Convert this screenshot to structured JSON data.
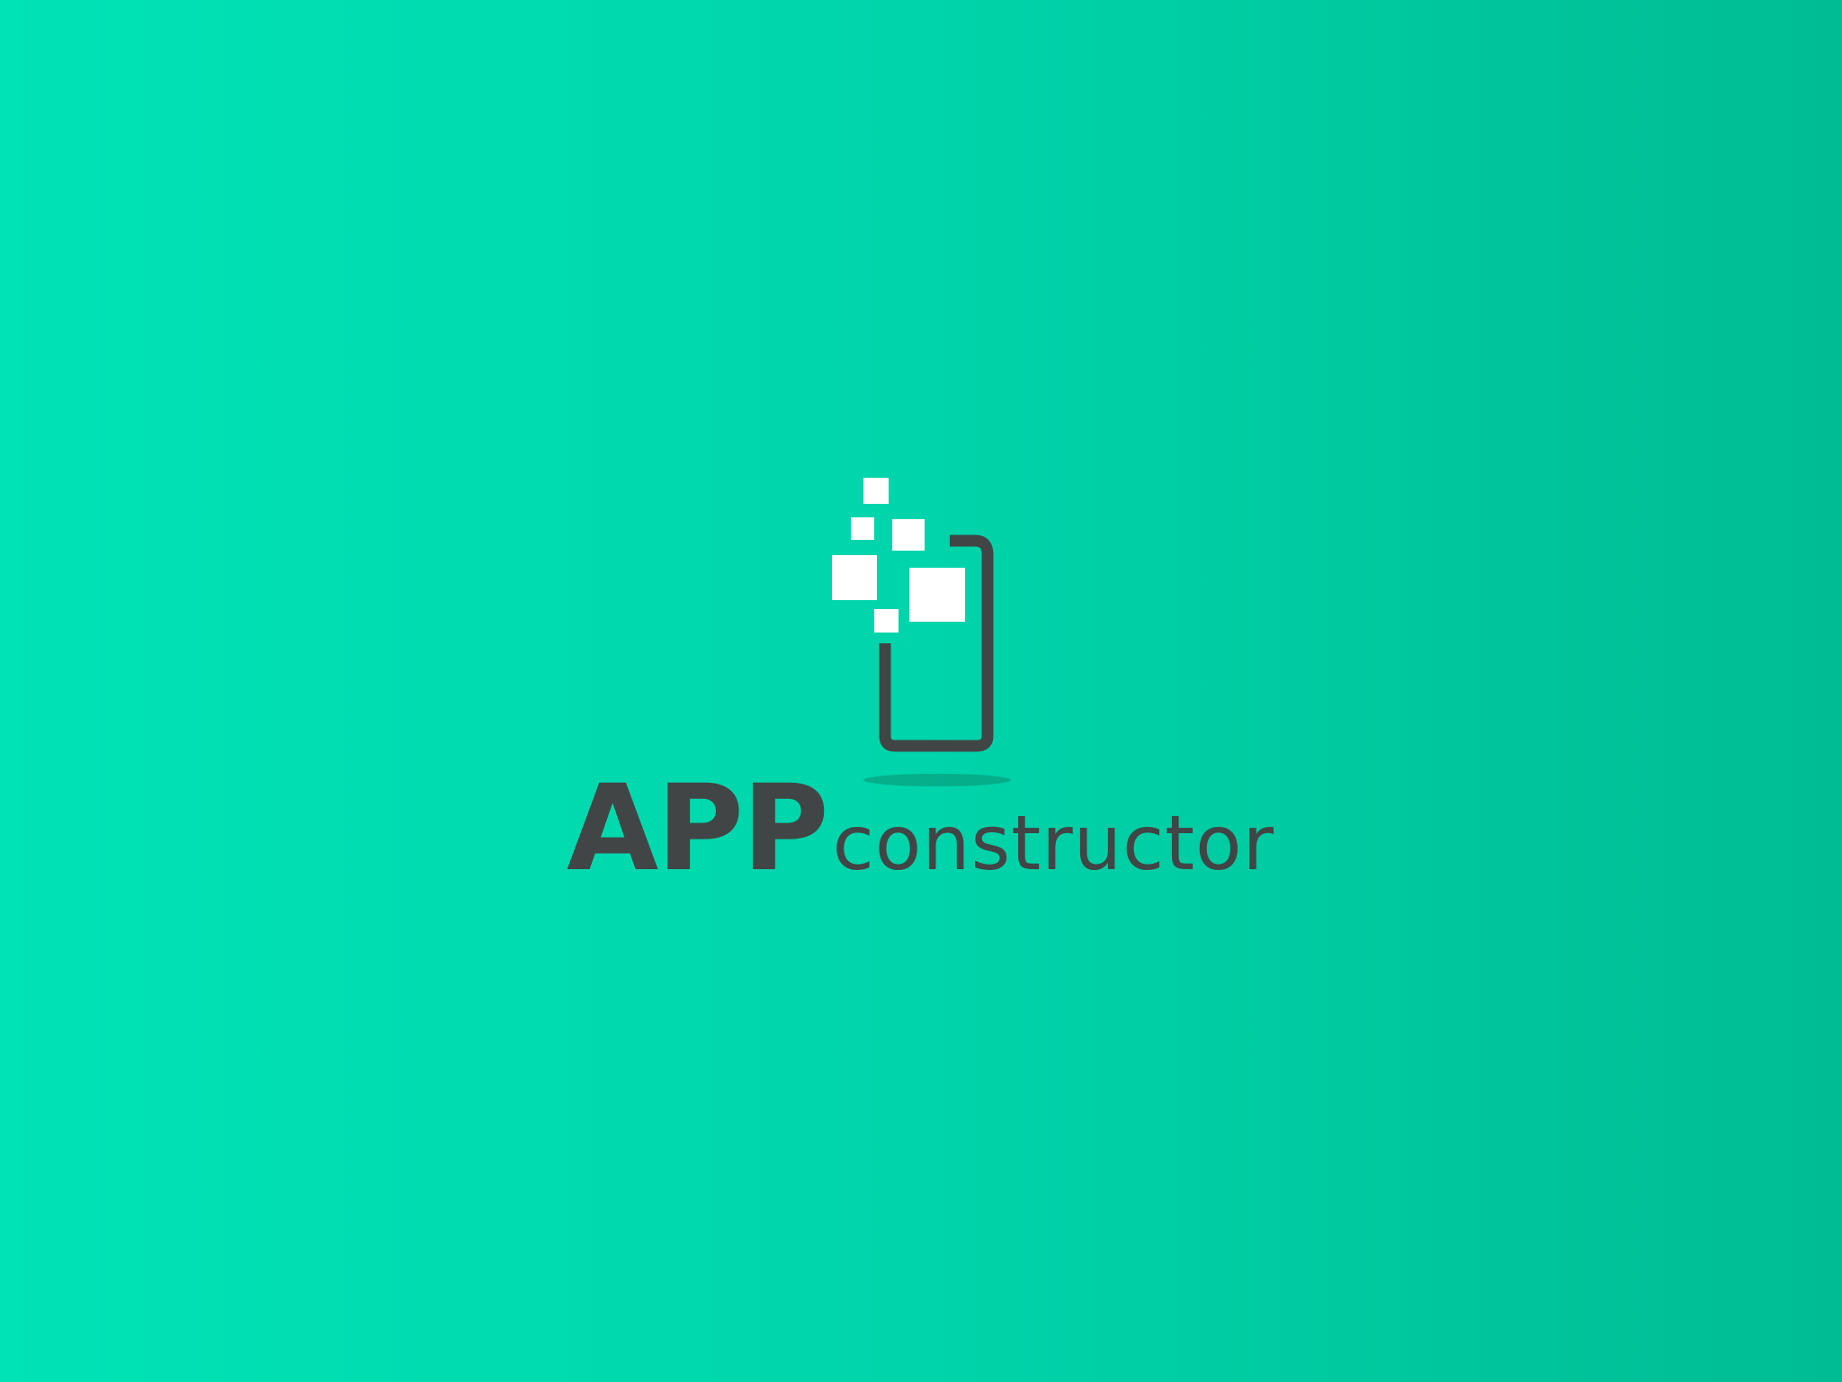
{
  "logo": {
    "brand_strong": "APP",
    "brand_light": "constructor",
    "icon": "phone-with-pixels-icon",
    "colors": {
      "background_start": "#00e3b6",
      "background_end": "#00bc94",
      "ink": "#414545",
      "pixels": "#ffffff"
    }
  }
}
